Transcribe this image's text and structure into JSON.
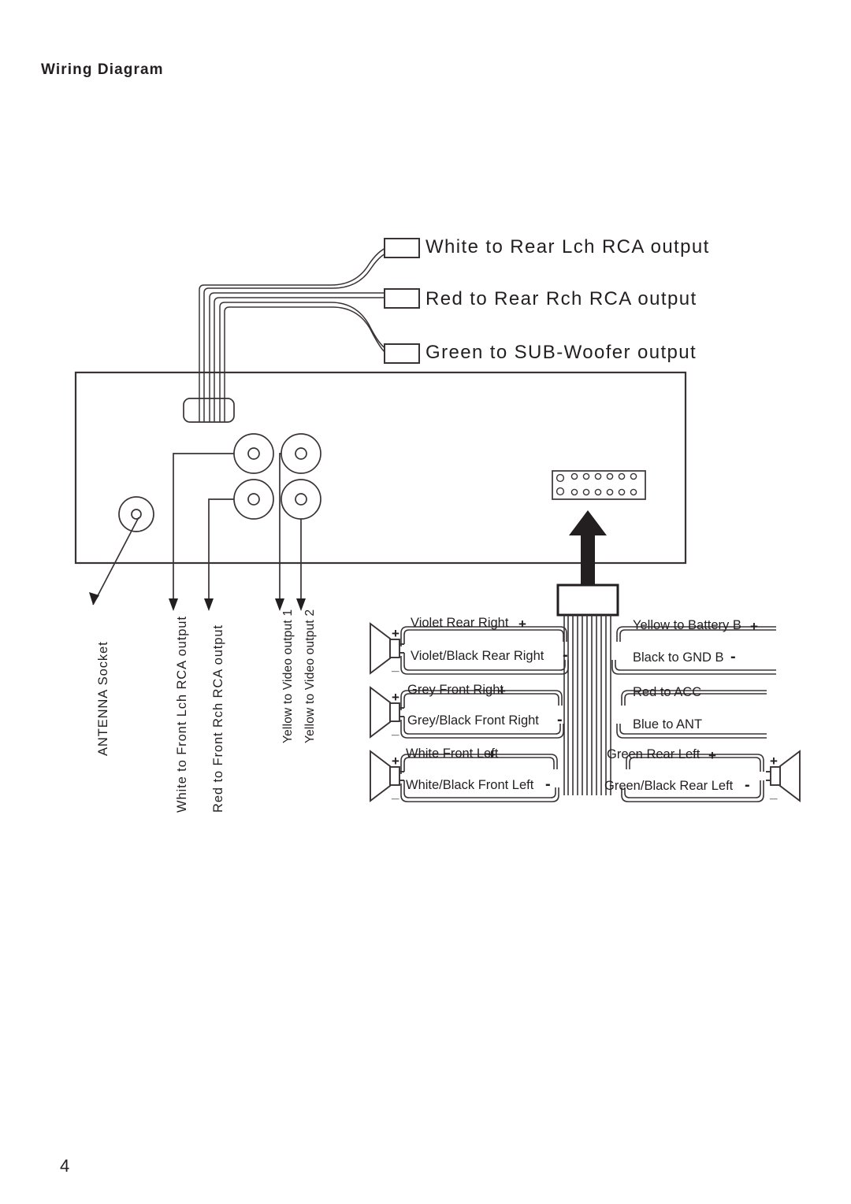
{
  "document": {
    "title": "Wiring Diagram",
    "page_number": "4"
  },
  "rca_outputs": [
    {
      "id": "rear-lch",
      "label": "White to Rear  Lch RCA  output"
    },
    {
      "id": "rear-rch",
      "label": "Red to Rear  Rch RCA  output"
    },
    {
      "id": "subwoofer",
      "label": "Green to SUB-Woofer output"
    }
  ],
  "unit_jack_labels": [
    {
      "id": "antenna-socket",
      "label": "ANTENNA Socket"
    },
    {
      "id": "front-lch",
      "label": "White to Front  Lch RCA  output"
    },
    {
      "id": "front-rch",
      "label": "Red to Front  Rch RCA  output"
    },
    {
      "id": "video-output-1",
      "label": "Yellow to Video output 1"
    },
    {
      "id": "video-output-2",
      "label": "Yellow to Video output 2"
    }
  ],
  "harness": {
    "left_column": [
      {
        "id": "violet-rear-right-pos",
        "label": "Violet Rear Right",
        "polarity": "+"
      },
      {
        "id": "violet-black-rear-right-neg",
        "label": "Violet/Black Rear Right",
        "polarity": "-"
      },
      {
        "id": "grey-front-right-pos",
        "label": "Grey Front Right",
        "polarity": "+"
      },
      {
        "id": "grey-black-front-right-neg",
        "label": "Grey/Black Front Right",
        "polarity": "-"
      },
      {
        "id": "white-front-left-pos",
        "label": "White Front Left",
        "polarity": "+"
      },
      {
        "id": "white-black-front-left-neg",
        "label": "White/Black Front Left",
        "polarity": "-"
      }
    ],
    "right_column": [
      {
        "id": "yellow-battery",
        "label": "Yellow to Battery B",
        "polarity": "+"
      },
      {
        "id": "black-gnd",
        "label": "Black to GND B",
        "polarity": "-"
      },
      {
        "id": "red-acc",
        "label": "Red to ACC",
        "polarity": ""
      },
      {
        "id": "blue-ant",
        "label": "Blue to ANT",
        "polarity": ""
      },
      {
        "id": "green-rear-left-pos",
        "label": "Green Rear Left",
        "polarity": "+"
      },
      {
        "id": "green-black-rear-left-neg",
        "label": "Green/Black Rear Left",
        "polarity": "-"
      }
    ],
    "speaker_terminals": {
      "positive": "+",
      "negative": "_"
    }
  },
  "colors": {
    "ink": "#231f20",
    "line": "#3a3336",
    "background": "#ffffff"
  }
}
